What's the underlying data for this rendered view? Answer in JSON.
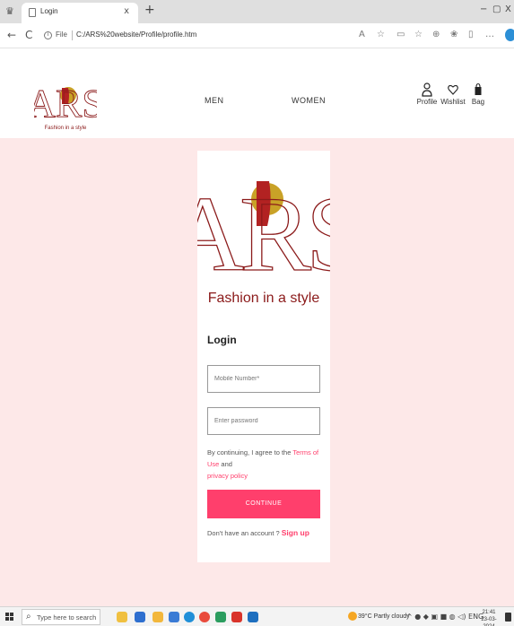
{
  "browser": {
    "tab_title": "Login",
    "tab_close": "x",
    "new_tab": "+",
    "window_minimize": "−",
    "window_restore": "▢",
    "window_close": "X",
    "back": "←",
    "refresh": "C",
    "info_glyph": "i",
    "file_label": "File",
    "url": "C:/ARS%20website/Profile/profile.htm",
    "toolbar_icons": [
      "A",
      "☆",
      "▭",
      "☆",
      "⊕",
      "❀",
      "▯",
      "…"
    ]
  },
  "header": {
    "logo_text": "ARS",
    "logo_tagline": "Fashion in a style",
    "nav": {
      "men": "MEN",
      "women": "WOMEN"
    },
    "actions": {
      "profile": "Profile",
      "wishlist": "Wishlist",
      "bag": "Bag"
    },
    "icons": [
      "person-icon",
      "heart-icon",
      "bag-icon"
    ]
  },
  "login": {
    "logo_text": "ARS",
    "logo_tagline": "Fashion in a style",
    "title": "Login",
    "mobile_placeholder": "Mobile Number*",
    "password_placeholder": "Enter password",
    "terms_prefix": "By continuing, I agree to the ",
    "terms_link": "Terms of Use",
    "terms_and": " and",
    "privacy_link": "privacy policy",
    "continue_label": "CONTINUE",
    "signup_prefix": "Don't have an account ? ",
    "signup_link": "Sign up"
  },
  "taskbar": {
    "search_placeholder": "Type here to search",
    "search_glyph": "⌕",
    "weather": "39°C Partly cloudy",
    "tray_glyphs": "^ ● ◆ ▣ ■ ◍ ◁) ENG",
    "time": "21:41",
    "date": "23-03-2024"
  },
  "colors": {
    "accent": "#ff3f6c",
    "background": "#fde8e8",
    "logo_maroon": "#8b1a1a",
    "logo_gold": "#c9a227",
    "logo_red": "#b22222"
  }
}
